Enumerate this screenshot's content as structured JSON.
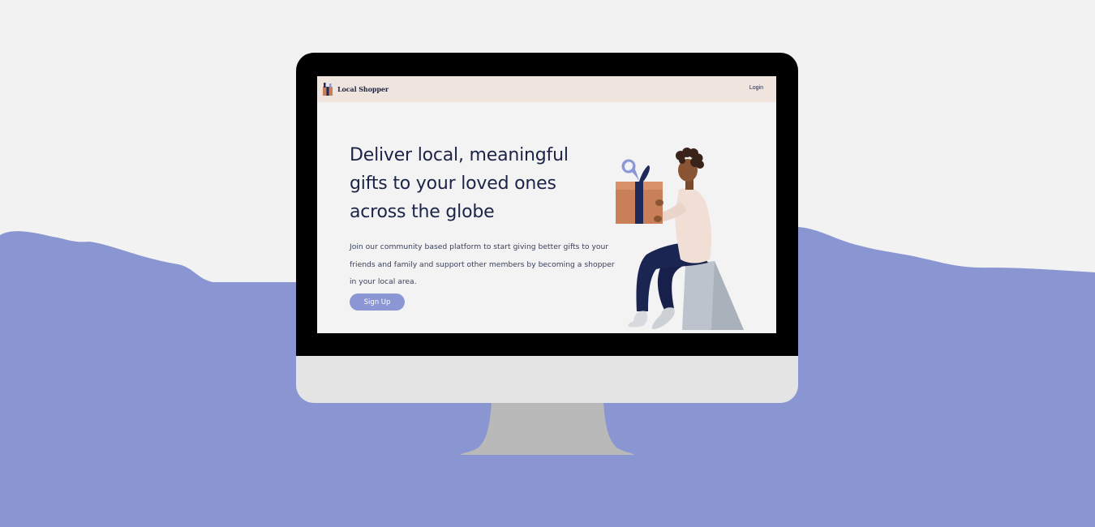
{
  "colors": {
    "page_background": "#f2f2f2",
    "wave": "#8a96d2",
    "bezel": "#000000",
    "chin": "#e4e4e4",
    "stand": "#b9b9b9",
    "site_nav_bg": "#f0e4df",
    "site_body_bg": "#f3f3f3",
    "headline_text": "#1b2447",
    "button_bg": "#8b97d4",
    "gift_box": "#c97f57",
    "ribbon": "#1d2a5a",
    "bow": "#8b97d4"
  },
  "site": {
    "brand": {
      "name": "Local Shopper",
      "icon": "gift-logo-icon"
    },
    "nav": {
      "login_label": "Login"
    },
    "hero": {
      "headline": "Deliver local, meaningful gifts to your loved ones across the globe",
      "description": "Join our community based platform to start giving better gifts to your friends and family and support other members by becoming a shopper in your local area.",
      "signup_label": "Sign Up"
    },
    "illustration": {
      "subject": "person-holding-gift-illustration"
    }
  }
}
